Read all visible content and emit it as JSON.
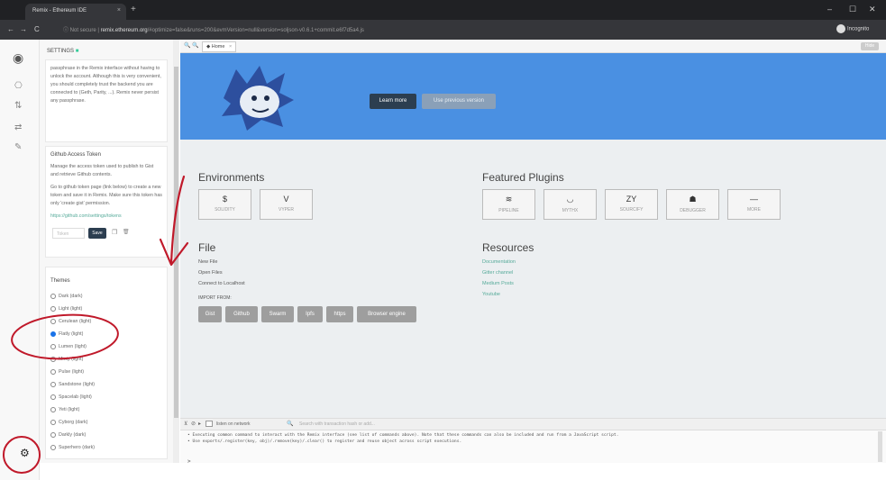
{
  "browser": {
    "tab_title": "Remix - Ethereum IDE",
    "tab_close": "×",
    "new_tab": "+",
    "nav_back": "←",
    "nav_forward": "→",
    "nav_reload": "C",
    "security": "ⓘ Not secure",
    "url_host": "remix.ethereum.org",
    "url_rest": "/#optimize=false&runs=200&evmVersion=null&version=soljson-v0.6.1+commit.e6f7d5a4.js",
    "profile": "Incognito",
    "window_controls": [
      "–",
      "☐",
      "✕"
    ]
  },
  "icon_bar": {
    "icons": [
      "remix-logo-icon",
      "file-explorer-icon",
      "compiler-icon",
      "deploy-icon",
      "plugin-manager-icon"
    ],
    "glyphs": [
      "◉",
      "⎔",
      "⇅",
      "⇄",
      "✎"
    ],
    "settings_icon": "⚙"
  },
  "settings": {
    "header": "SETTINGS",
    "header_check": "■",
    "passphrase_text": "passphrase in the Remix interface without having to unlock the account. Although this is very convenient, you should completely trust the backend you are connected to (Geth, Parity, ...). Remix never persist any passphrase.",
    "github": {
      "title": "Github Access Token",
      "desc1": "Manage the access token used to publish to Gist and retrieve Github contents.",
      "desc2": "Go to github token page (link below) to create a new token and save it in Remix. Make sure this token has only 'create gist' permission.",
      "link": "https://github.com/settings/tokens",
      "token_placeholder": "Token",
      "save_label": "Save",
      "copy_icon": "❐",
      "delete_icon": "🗑"
    },
    "themes_title": "Themes",
    "themes": [
      {
        "label": "Dark (dark)",
        "selected": false
      },
      {
        "label": "Light (light)",
        "selected": false
      },
      {
        "label": "Cerulean (light)",
        "selected": false
      },
      {
        "label": "Flatly (light)",
        "selected": true
      },
      {
        "label": "Lumen (light)",
        "selected": false
      },
      {
        "label": "Minty (light)",
        "selected": false
      },
      {
        "label": "Pulse (light)",
        "selected": false
      },
      {
        "label": "Sandstone (light)",
        "selected": false
      },
      {
        "label": "Spacelab (light)",
        "selected": false
      },
      {
        "label": "Yeti (light)",
        "selected": false
      },
      {
        "label": "Cyborg (dark)",
        "selected": false
      },
      {
        "label": "Darkly (dark)",
        "selected": false
      },
      {
        "label": "Superhero (dark)",
        "selected": false
      }
    ]
  },
  "editor_tabs": {
    "zoom_out": "🔍",
    "zoom_in": "🔍",
    "home_tab": "◆ Home",
    "home_close": "×",
    "corner": "Hide"
  },
  "home": {
    "learn_more": "Learn more",
    "previous_version": "Use previous version",
    "environments_title": "Environments",
    "environments": [
      {
        "glyph": "$",
        "label": "SOLIDITY"
      },
      {
        "glyph": "V",
        "label": "VYPER"
      }
    ],
    "featured_title": "Featured Plugins",
    "plugins": [
      {
        "glyph": "≋",
        "label": "PIPELINE"
      },
      {
        "glyph": "◡",
        "label": "MYTHX"
      },
      {
        "glyph": "ZY",
        "label": "SOURCIFY"
      },
      {
        "glyph": "☗",
        "label": "DEBUGGER"
      },
      {
        "glyph": "—",
        "label": "MORE"
      }
    ],
    "file_title": "File",
    "file_links": [
      "New File",
      "Open Files",
      "Connect to Localhost"
    ],
    "import_label": "IMPORT FROM:",
    "import_buttons": [
      "Gist",
      "Github",
      "Swarm",
      "Ipfs",
      "https",
      "Browser engine"
    ],
    "resources_title": "Resources",
    "resource_links": [
      "Documentation",
      "Gitter channel",
      "Medium Posts",
      "Youtube"
    ]
  },
  "terminal": {
    "icons": [
      "⊻",
      "⊘",
      "▸"
    ],
    "listen_label": "listen on network",
    "search_icon": "🔍",
    "search_placeholder": "Search with transaction hash or add...",
    "lines": [
      "• Executing common command to interact with the Remix interface (see list of commands above). Note that these commands can also be included and run from a JavaScript script.",
      "• Use exports/.register(key, obj)/.remove(key)/.clear() to register and reuse object across script executions."
    ],
    "prompt": ">"
  },
  "colors": {
    "hero": "#4a90e2",
    "annotation": "#c0192a",
    "browser_chrome": "#202124"
  }
}
